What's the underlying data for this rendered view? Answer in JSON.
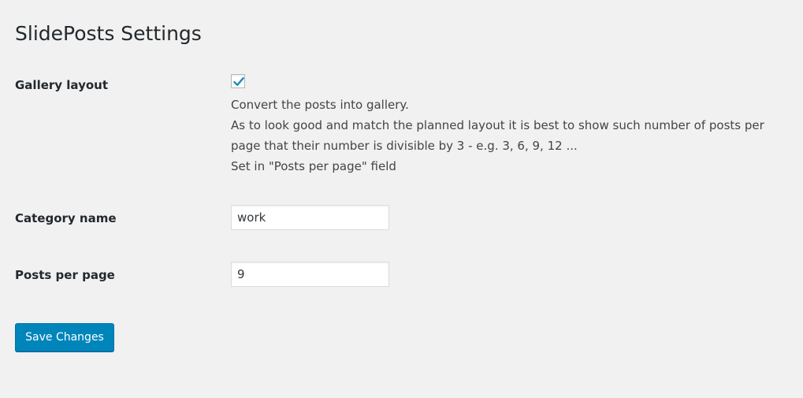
{
  "page": {
    "title": "SlidePosts Settings"
  },
  "settings": {
    "gallery_layout": {
      "label": "Gallery layout",
      "checked": true,
      "description": [
        "Convert the posts into gallery.",
        "As to look good and match the planned layout it is best to show such number of posts per page that their number is divisible by 3 - e.g. 3, 6, 9, 12 ...",
        "Set in \"Posts per page\" field"
      ]
    },
    "category_name": {
      "label": "Category name",
      "value": "work"
    },
    "posts_per_page": {
      "label": "Posts per page",
      "value": "9"
    }
  },
  "actions": {
    "save_label": "Save Changes"
  },
  "colors": {
    "background": "#f1f1f1",
    "primary_button": "#0085ba",
    "checkmark": "#1e8cbe"
  }
}
